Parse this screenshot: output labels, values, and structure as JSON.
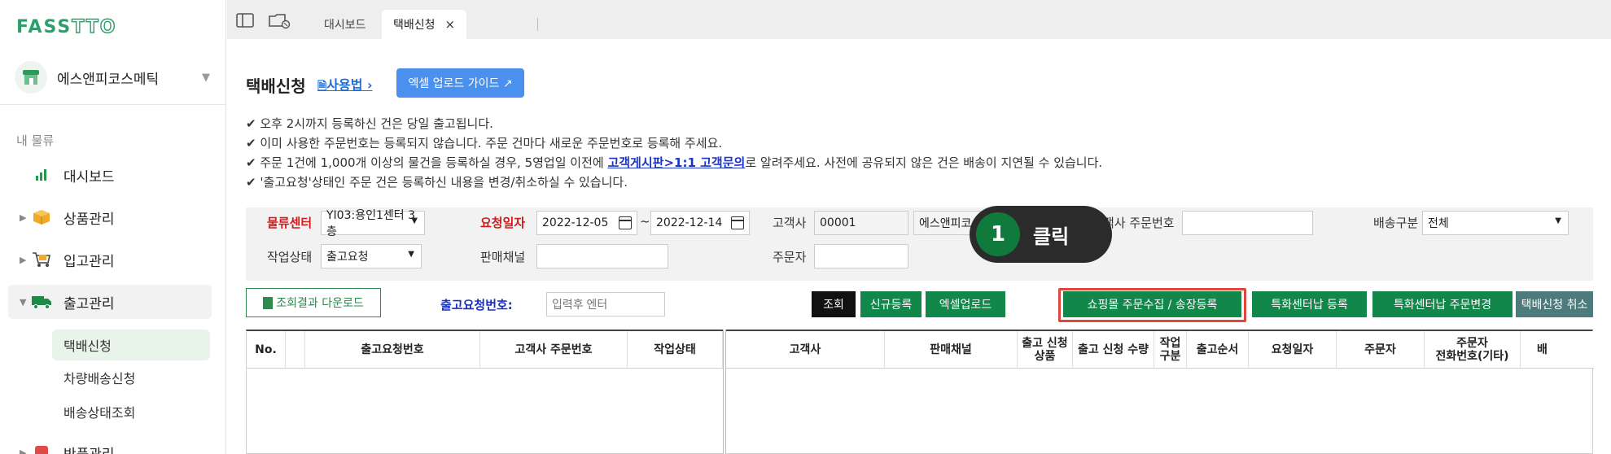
{
  "app": {
    "logo_text_a": "FASS",
    "logo_text_b": "TTO"
  },
  "sidebar": {
    "company": "에스앤피코스메틱",
    "section_label": "내 물류",
    "items": [
      {
        "label": "대시보드",
        "icon": "bar-chart-icon"
      },
      {
        "label": "상품관리",
        "icon": "box-icon"
      },
      {
        "label": "입고관리",
        "icon": "cart-icon"
      },
      {
        "label": "출고관리",
        "icon": "truck-icon"
      },
      {
        "label": "반품관리",
        "icon": "return-icon"
      }
    ],
    "sub_items": [
      {
        "label": "택배신청"
      },
      {
        "label": "차량배송신청"
      },
      {
        "label": "배송상태조회"
      }
    ]
  },
  "tabs": [
    {
      "label": "대시보드"
    },
    {
      "label": "택배신청",
      "close": "×"
    }
  ],
  "page": {
    "title": "택배신청",
    "usage_link": "사용법",
    "guide_button": "엑셀 업로드 가이드 ↗",
    "notes": [
      {
        "pre": "✔ 오후 2시까지 등록하신 건은 당일 출고됩니다.",
        "link": "",
        "post": ""
      },
      {
        "pre": "✔ 이미 사용한 주문번호는 등록되지 않습니다. 주문 건마다 새로운 주문번호로 등록해 주세요.",
        "link": "",
        "post": ""
      },
      {
        "pre": "✔ 주문 1건에 1,000개 이상의 물건을 등록하실 경우, 5영업일 이전에 ",
        "link": "고객게시판>1:1 고객문의",
        "post": "로 알려주세요. 사전에 공유되지 않은 건은 배송이 지연될 수 있습니다."
      },
      {
        "pre": "✔ '출고요청'상태인 주문 건은 등록하신 내용을 변경/취소하실 수 있습니다.",
        "link": "",
        "post": ""
      }
    ]
  },
  "filters": {
    "center_label": "물류센터",
    "center_value": "YI03:용인1센터 3층",
    "date_label": "요청일자",
    "date_from": "2022-12-05",
    "date_sep": "~",
    "date_to": "2022-12-14",
    "client_label": "고객사",
    "client_code": "00001",
    "client_name": "에스앤피코",
    "order_no_label": "객사 주문번호",
    "order_no_value": "",
    "ship_type_label": "배송구분",
    "ship_type_value": "전체",
    "status_label": "작업상태",
    "status_value": "출고요청",
    "channel_label": "판매채널",
    "channel_value": "",
    "orderer_label": "주문자",
    "orderer_value": ""
  },
  "actions": {
    "download": "조회결과 다운로드",
    "request_no_label": "출고요청번호:",
    "request_no_placeholder": "입력후 엔터",
    "buttons": [
      {
        "label": "조회",
        "style": "black"
      },
      {
        "label": "신규등록",
        "style": "green"
      },
      {
        "label": "엑셀업로드",
        "style": "green"
      },
      {
        "label": "쇼핑몰 주문수집 / 송장등록",
        "style": "green"
      },
      {
        "label": "특화센터납 등록",
        "style": "green"
      },
      {
        "label": "특화센터납 주문변경",
        "style": "green"
      },
      {
        "label": "택배신청 취소",
        "style": "slate"
      }
    ]
  },
  "callout": {
    "number": "1",
    "text": "클릭"
  },
  "grid": {
    "columns": [
      "No.",
      "",
      "출고요청번호",
      "고객사 주문번호",
      "작업상태",
      "고객사",
      "판매채널",
      "출고 신청\n상품",
      "출고 신청 수량",
      "작업\n구분",
      "출고순서",
      "요청일자",
      "주문자",
      "주문자\n전화번호(기타)",
      "배"
    ]
  },
  "colors": {
    "brand": "#2f9e6e",
    "primary_green": "#12874a",
    "highlight": "#e0443a",
    "link_blue": "#1d34c4"
  }
}
